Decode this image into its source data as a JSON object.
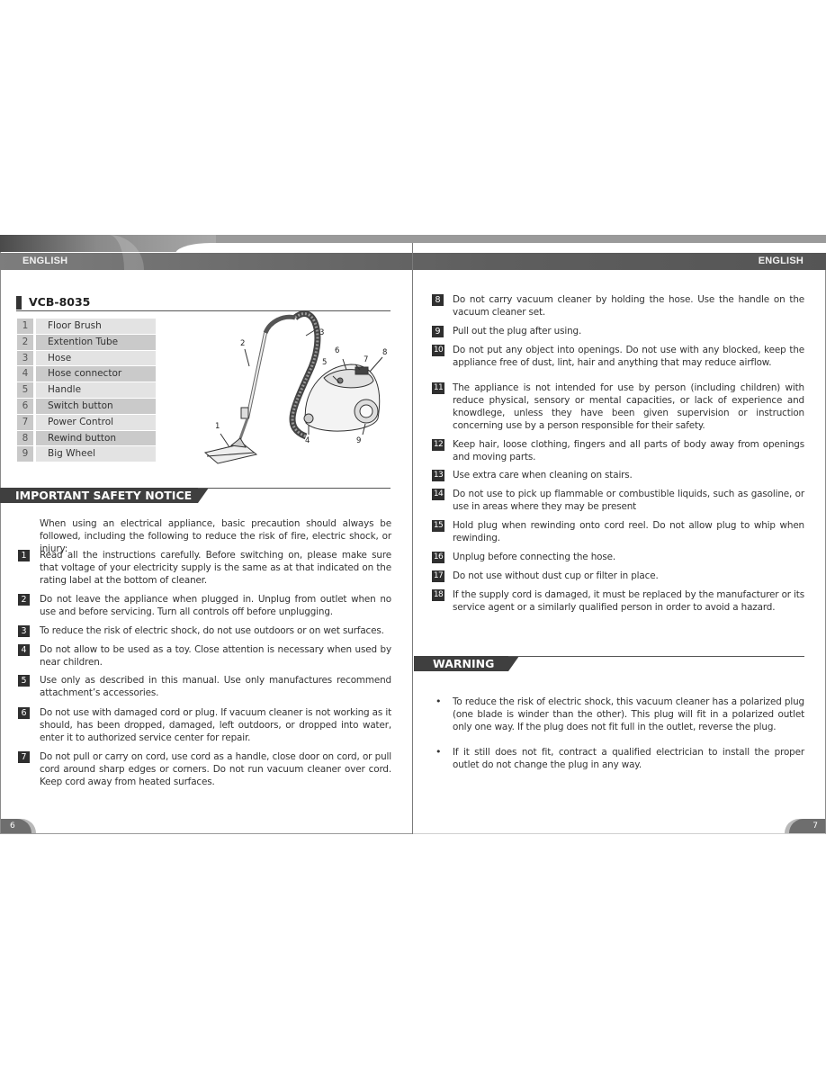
{
  "header": {
    "left_language": "ENGLISH",
    "right_language": "ENGLISH"
  },
  "model": {
    "title": "VCB-8035"
  },
  "parts": [
    {
      "number": "1",
      "name": "Floor Brush"
    },
    {
      "number": "2",
      "name": "Extention Tube"
    },
    {
      "number": "3",
      "name": "Hose"
    },
    {
      "number": "4",
      "name": "Hose connector"
    },
    {
      "number": "5",
      "name": "Handle"
    },
    {
      "number": "6",
      "name": "Switch button"
    },
    {
      "number": "7",
      "name": "Power Control"
    },
    {
      "number": "8",
      "name": "Rewind button"
    },
    {
      "number": "9",
      "name": "Big Wheel"
    }
  ],
  "diagram": {
    "callouts": [
      "1",
      "2",
      "3",
      "4",
      "5",
      "6",
      "7",
      "8",
      "9"
    ]
  },
  "safety": {
    "heading": "IMPORTANT SAFETY NOTICE",
    "intro": "When using an electrical appliance, basic precaution should always be followed, including the following to reduce the risk of fire, electric shock, or injury:",
    "items": [
      {
        "number": "1",
        "text": "Read all the instructions carefully. Before switching on, please make sure that voltage of your electricity supply is the same as at that indicated on the rating label at the bottom of cleaner."
      },
      {
        "number": "2",
        "text": "Do not leave the appliance when plugged in. Unplug from outlet when no use and before servicing. Turn all controls off before unplugging."
      },
      {
        "number": "3",
        "text": "To reduce the risk of electric shock, do not use outdoors or on wet surfaces."
      },
      {
        "number": "4",
        "text": "Do not allow to be used as a toy. Close attention is necessary when used by near children."
      },
      {
        "number": "5",
        "text": "Use only as described in this manual. Use only manufactures recommend attachment’s accessories."
      },
      {
        "number": "6",
        "text": "Do not use with damaged cord or plug. If vacuum cleaner is not working as it should, has been dropped, damaged, left outdoors, or dropped into water, enter it to authorized service center for repair."
      },
      {
        "number": "7",
        "text": "Do not pull or carry on cord, use cord as a handle, close door on cord, or pull cord around sharp edges or corners. Do not run vacuum cleaner over cord. Keep cord away from heated surfaces."
      },
      {
        "number": "8",
        "text": "Do not carry vacuum cleaner by holding the hose. Use the handle on the vacuum cleaner set."
      },
      {
        "number": "9",
        "text": "Pull out the plug after using."
      },
      {
        "number": "10",
        "text": "Do not put any object into openings. Do not use with any blocked, keep the appliance free of dust, lint, hair and anything that may reduce airflow."
      },
      {
        "number": "11",
        "text": "The appliance is not intended for use by person (including children) with reduce physical, sensory or mental capacities, or lack of experience and knowdlege, unless they have been given supervision or instruction concerning use by a person responsible for their safety."
      },
      {
        "number": "12",
        "text": "Keep hair, loose clothing, fingers and all parts of body away from openings and moving parts."
      },
      {
        "number": "13",
        "text": "Use extra care when cleaning on stairs."
      },
      {
        "number": "14",
        "text": "Do not use to pick up flammable or combustible liquids, such as gasoline, or use in areas where they may be present"
      },
      {
        "number": "15",
        "text": "Hold plug when rewinding onto cord reel. Do not allow plug to whip when rewinding."
      },
      {
        "number": "16",
        "text": "Unplug before connecting the hose."
      },
      {
        "number": "17",
        "text": "Do not use without dust cup or filter in place."
      },
      {
        "number": "18",
        "text": "If the supply cord is damaged, it must be replaced by the manufacturer or its service agent or a similarly qualified person in order to avoid a hazard."
      }
    ]
  },
  "warning": {
    "heading": "WARNING",
    "bullets": [
      "To reduce the risk of electric shock, this vacuum cleaner has a polarized plug (one blade is winder than the other). This plug will fit in a polarized outlet only one way. If the plug does not fit full in the outlet, reverse the plug.",
      "If it still does not fit, contract a qualified electrician to install the proper outlet do not change the plug in any way."
    ]
  },
  "footer": {
    "left_page_number": "6",
    "right_page_number": "7"
  }
}
